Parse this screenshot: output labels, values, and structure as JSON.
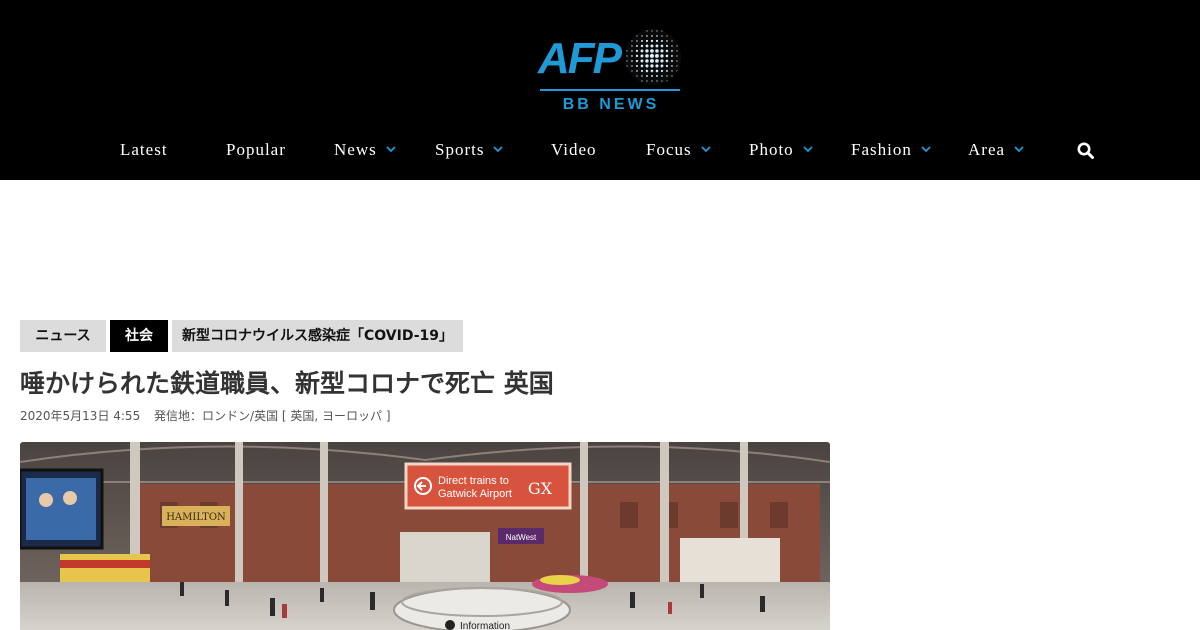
{
  "header": {
    "logo": {
      "wordmark": "AFP",
      "subtitle": "BB NEWS",
      "brand_color": "#1f9ad6"
    },
    "nav": [
      {
        "label": "Latest",
        "has_dropdown": false
      },
      {
        "label": "Popular",
        "has_dropdown": false
      },
      {
        "label": "News",
        "has_dropdown": true
      },
      {
        "label": "Sports",
        "has_dropdown": true
      },
      {
        "label": "Video",
        "has_dropdown": false
      },
      {
        "label": "Focus",
        "has_dropdown": true
      },
      {
        "label": "Photo",
        "has_dropdown": true
      },
      {
        "label": "Fashion",
        "has_dropdown": true
      },
      {
        "label": "Area",
        "has_dropdown": true
      }
    ],
    "search_icon": "search-icon",
    "background": "#000000"
  },
  "article": {
    "tags": [
      {
        "label": "ニュース",
        "style": "light"
      },
      {
        "label": "社会",
        "style": "dark"
      },
      {
        "label": "新型コロナウイルス感染症「COVID-19」",
        "style": "light"
      }
    ],
    "headline": "唾かけられた鉄道職員、新型コロナで死亡 英国",
    "datetime": "2020年5月13日 4:55",
    "location": "発信地：ロンドン/英国 [ 英国, ヨーロッパ ]",
    "photo": {
      "sign_line1": "Direct trains to",
      "sign_line2": "Gatwick Airport",
      "sign_logo": "GX",
      "shop_sign": "HAMILTON",
      "bank_sign": "NatWest",
      "info_label": "Information"
    }
  }
}
